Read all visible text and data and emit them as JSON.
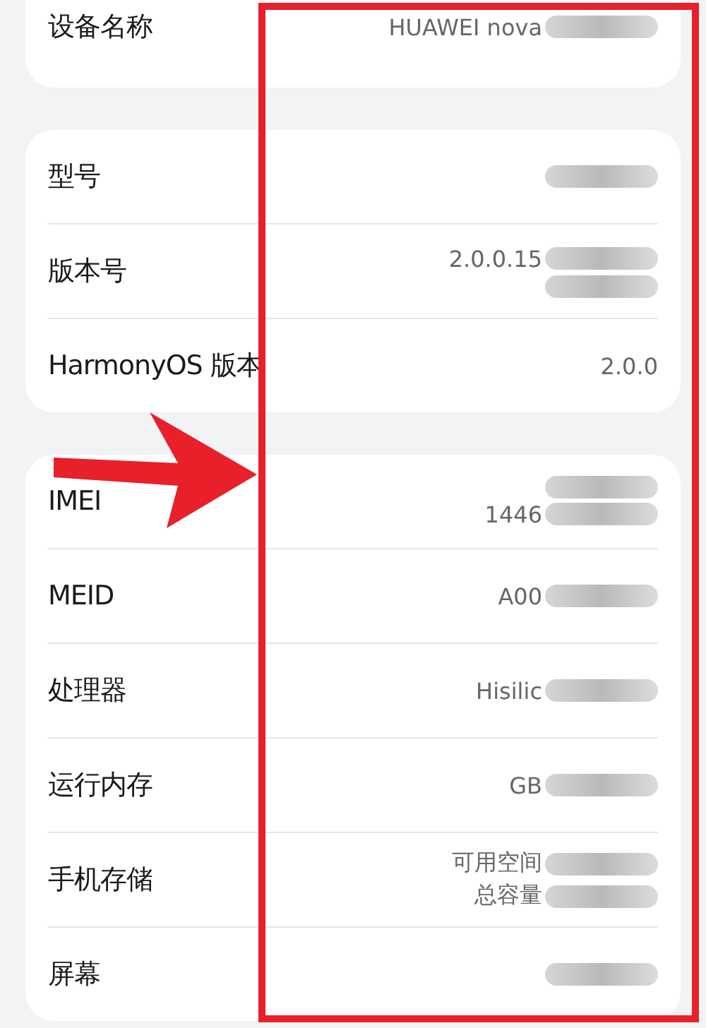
{
  "groups": [
    {
      "rows": [
        {
          "label": "设备名称",
          "values": [
            {
              "text": "HUAWEI nova",
              "redacted": true
            }
          ]
        }
      ]
    },
    {
      "rows": [
        {
          "label": "型号",
          "values": [
            {
              "redacted": true
            }
          ]
        },
        {
          "label": "版本号",
          "values": [
            {
              "text": "2.0.0.15",
              "redacted": true
            },
            {
              "redacted": true
            }
          ]
        },
        {
          "label": "HarmonyOS 版本",
          "values": [
            {
              "text": "2.0.0",
              "redacted": false
            }
          ]
        }
      ]
    },
    {
      "rows": [
        {
          "label": "IMEI",
          "values": [
            {
              "redacted": true
            },
            {
              "text": "1446",
              "redacted": true
            }
          ]
        },
        {
          "label": "MEID",
          "values": [
            {
              "text": "A00",
              "redacted": true
            }
          ]
        },
        {
          "label": "处理器",
          "values": [
            {
              "text": "Hisilic",
              "redacted": true
            }
          ]
        },
        {
          "label": "运行内存",
          "values": [
            {
              "text": "GB",
              "redacted": true
            }
          ]
        },
        {
          "label": "手机存储",
          "values": [
            {
              "text": "可用空间",
              "redacted": true
            },
            {
              "text": "总容量",
              "redacted": true
            }
          ]
        },
        {
          "label": "屏幕",
          "values": [
            {
              "redacted": true
            }
          ]
        }
      ]
    }
  ]
}
